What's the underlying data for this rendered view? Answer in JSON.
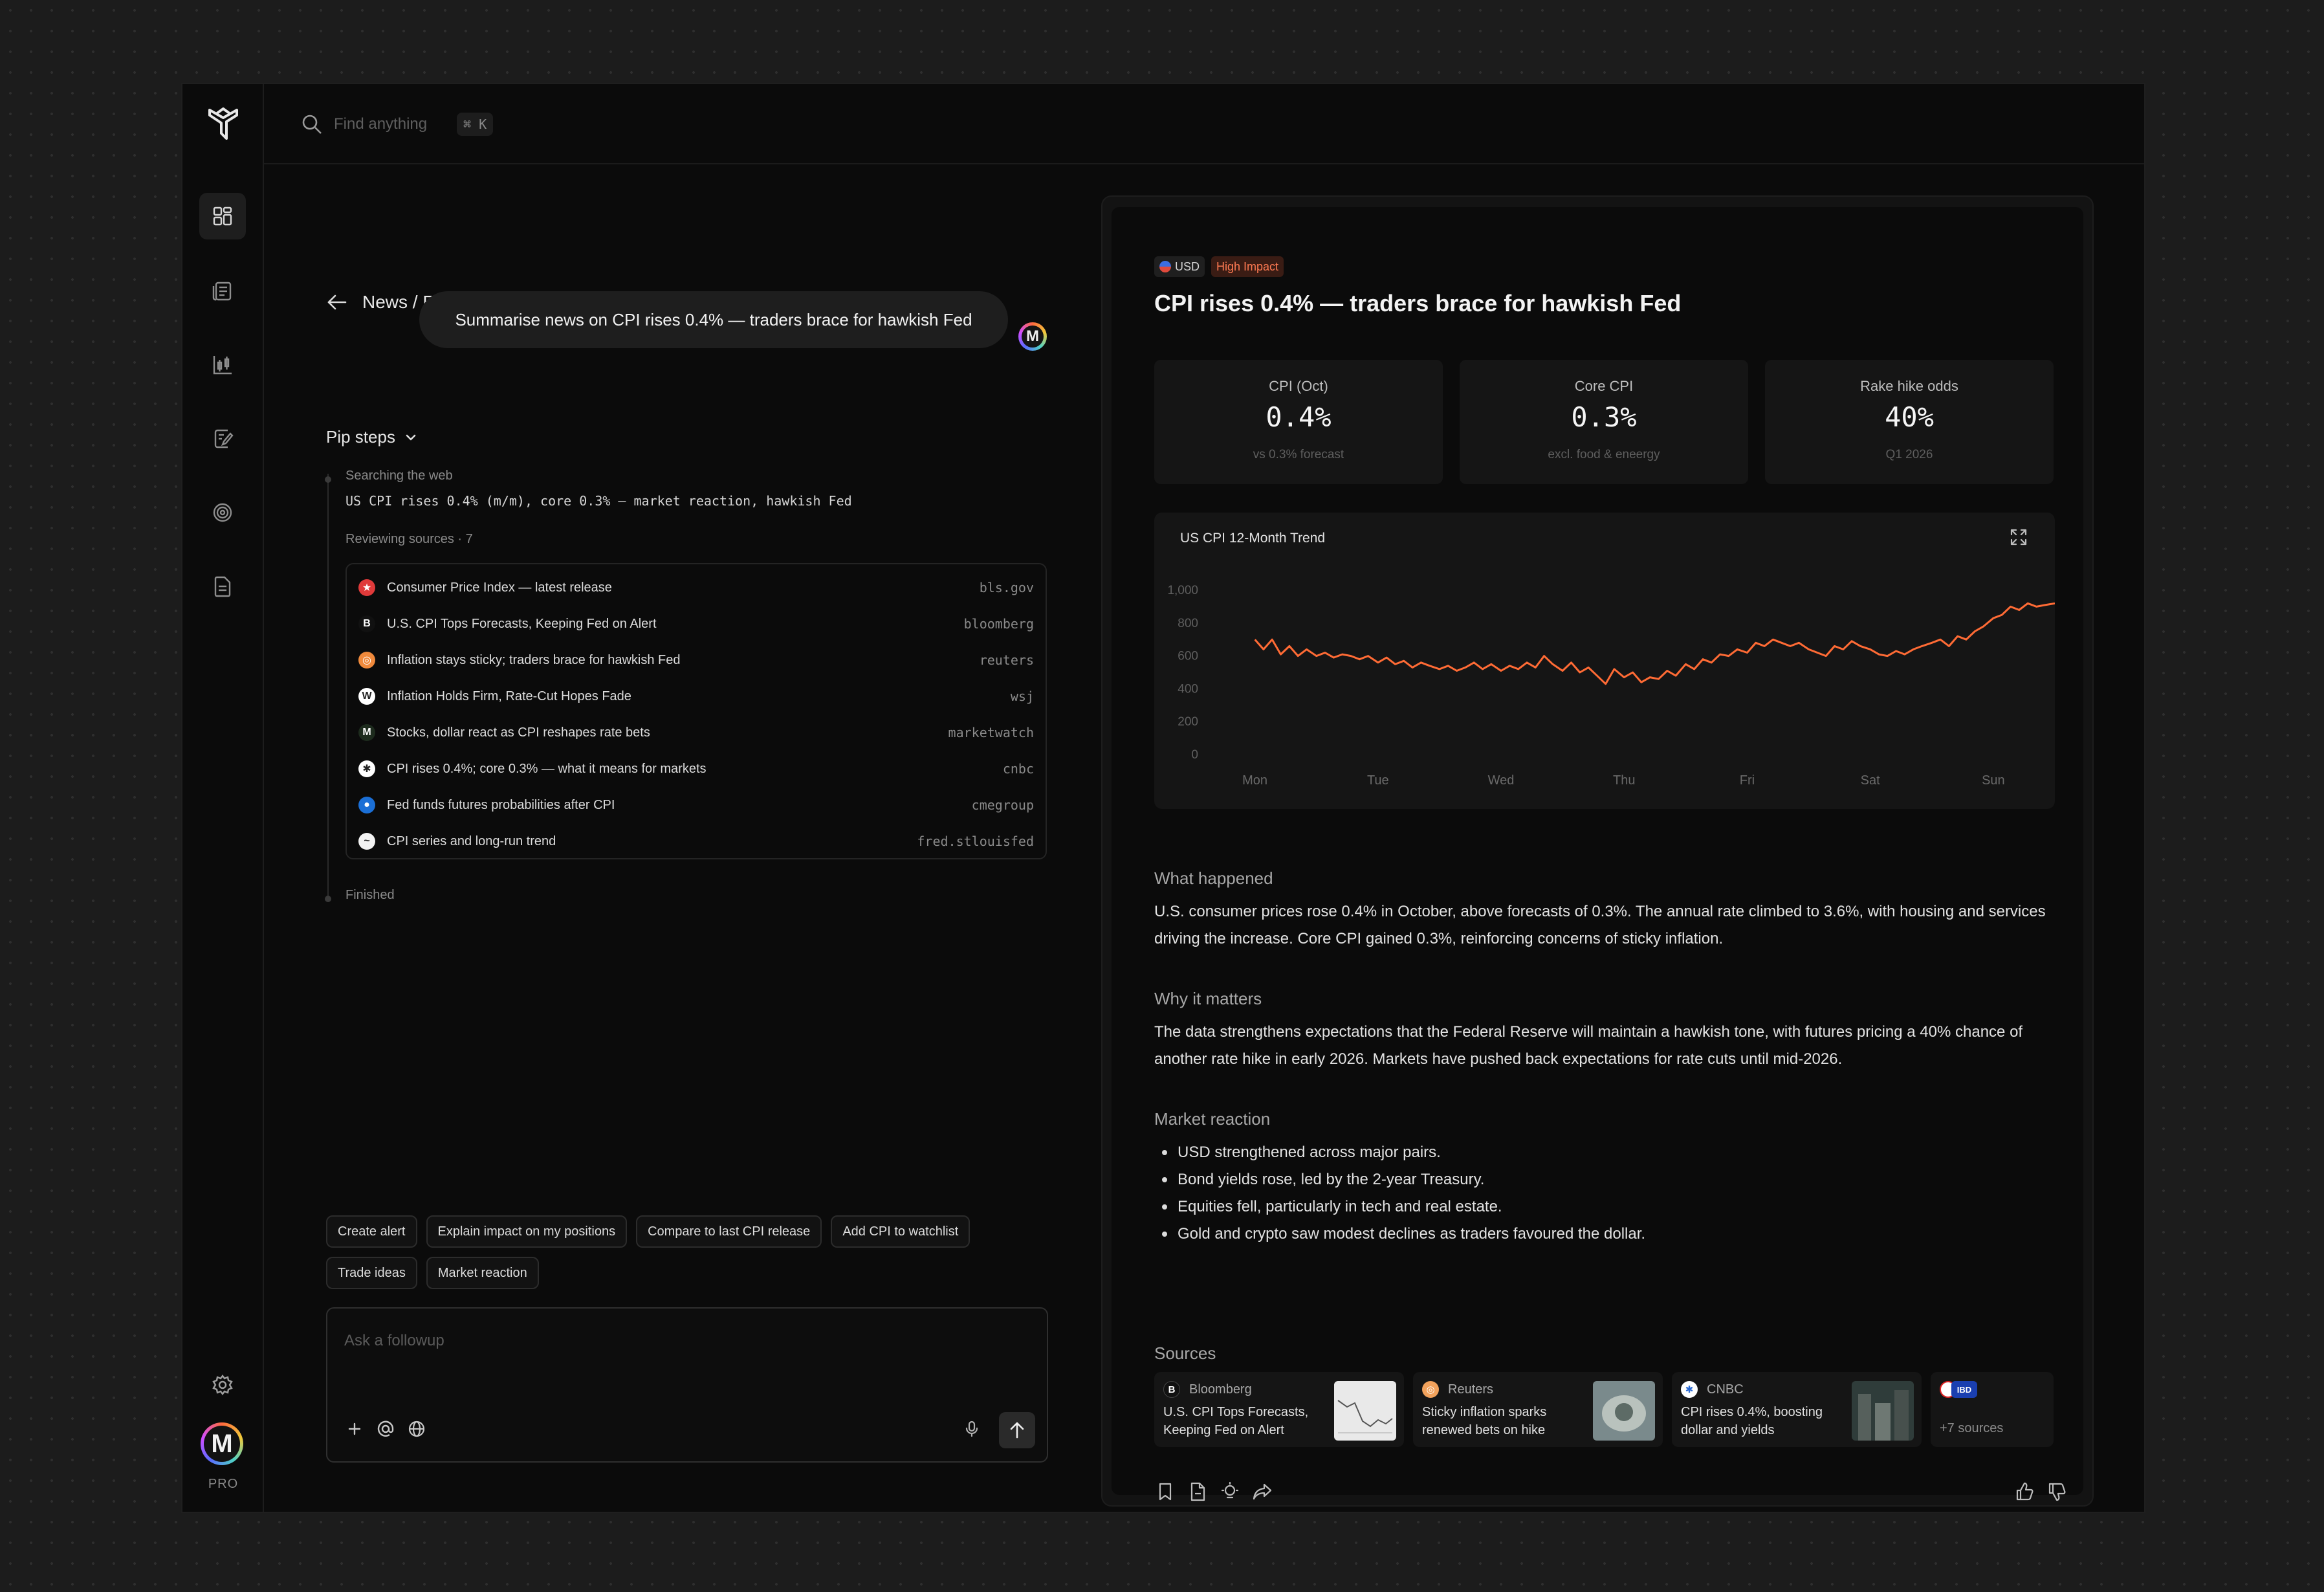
{
  "search": {
    "placeholder": "Find anything",
    "shortcut": "⌘ K"
  },
  "user": {
    "avatar_initial": "M",
    "plan": "PRO"
  },
  "breadcrumb": "News / Economy",
  "conversation": {
    "user_message": "Summarise news on CPI rises 0.4% — traders brace for hawkish Fed"
  },
  "pip_steps": {
    "toggle_label": "Pip steps",
    "searching_label": "Searching the web",
    "query": "US CPI rises 0.4% (m/m), core 0.3% — market reaction, hawkish Fed",
    "reviewing_label": "Reviewing sources · 7",
    "sources": [
      {
        "title": "Consumer Price Index — latest release",
        "domain": "bls.gov",
        "icon": "bls-icon",
        "color": "#e03a3a",
        "glyph": "★"
      },
      {
        "title": "U.S. CPI Tops Forecasts, Keeping Fed on Alert",
        "domain": "bloomberg",
        "icon": "bloomberg-icon",
        "color": "#111111",
        "glyph": "B"
      },
      {
        "title": "Inflation stays sticky; traders brace for hawkish Fed",
        "domain": "reuters",
        "icon": "reuters-icon",
        "color": "#f08a3c",
        "glyph": "◎"
      },
      {
        "title": "Inflation Holds Firm, Rate-Cut Hopes Fade",
        "domain": "wsj",
        "icon": "wsj-icon",
        "color": "#ffffff",
        "glyph": "W"
      },
      {
        "title": "Stocks, dollar react as CPI reshapes rate bets",
        "domain": "marketwatch",
        "icon": "marketwatch-icon",
        "color": "#1d2b1d",
        "glyph": "M"
      },
      {
        "title": "CPI rises 0.4%; core 0.3% — what it means for markets",
        "domain": "cnbc",
        "icon": "cnbc-icon",
        "color": "#ffffff",
        "glyph": "✱"
      },
      {
        "title": "Fed funds futures probabilities after CPI",
        "domain": "cmegroup",
        "icon": "cmegroup-icon",
        "color": "#1b6fd6",
        "glyph": "●"
      },
      {
        "title": "CPI series and long-run trend",
        "domain": "fred.stlouisfed",
        "icon": "fred-icon",
        "color": "#f3f3f3",
        "glyph": "~"
      }
    ],
    "finished_label": "Finished"
  },
  "suggestions": [
    "Create alert",
    "Explain impact on my positions",
    "Compare to last CPI release",
    "Add CPI to watchlist",
    "Trade ideas",
    "Market reaction"
  ],
  "composer": {
    "placeholder": "Ask a followup"
  },
  "article": {
    "currency_tag": "USD",
    "impact_tag": "High Impact",
    "title": "CPI rises 0.4% — traders brace for hawkish Fed",
    "stats": [
      {
        "label": "CPI (Oct)",
        "value": "0.4%",
        "sub": "vs 0.3% forecast"
      },
      {
        "label": "Core CPI",
        "value": "0.3%",
        "sub": "excl. food & eneergy"
      },
      {
        "label": "Rake hike odds",
        "value": "40%",
        "sub": "Q1 2026"
      }
    ],
    "what_happened_heading": "What happened",
    "what_happened_body": "U.S. consumer prices rose 0.4% in October, above forecasts of 0.3%. The annual rate climbed to 3.6%, with housing and services driving the increase. Core CPI gained 0.3%, reinforcing concerns of sticky inflation.",
    "why_matters_heading": "Why it matters",
    "why_matters_body": "The data strengthens expectations that the Federal Reserve will maintain a hawkish tone, with futures pricing a 40% chance of another rate hike in early 2026. Markets have pushed back expectations for rate cuts until mid-2026.",
    "market_reaction_heading": "Market reaction",
    "market_reaction_bullets": [
      "USD strengthened across major pairs.",
      "Bond yields rose, led by the 2-year Treasury.",
      "Equities fell, particularly in tech and real estate.",
      "Gold and crypto saw modest declines as traders favoured the dollar."
    ],
    "sources_heading": "Sources",
    "source_cards": [
      {
        "name": "Bloomberg",
        "headline": "U.S. CPI Tops Forecasts, Keeping Fed on Alert"
      },
      {
        "name": "Reuters",
        "headline": "Sticky inflation sparks renewed bets on hike"
      },
      {
        "name": "CNBC",
        "headline": "CPI rises 0.4%, boosting dollar and yields"
      }
    ],
    "more_sources_badge": "IBD",
    "more_sources": "+7 sources"
  },
  "chart_data": {
    "type": "line",
    "title": "US CPI 12-Month Trend",
    "categories": [
      "Mon",
      "Tue",
      "Wed",
      "Thu",
      "Fri",
      "Sat",
      "Sun"
    ],
    "y_ticks": [
      "0",
      "200",
      "400",
      "600",
      "800",
      "1,000"
    ],
    "ylim": [
      0,
      1000
    ],
    "grid": false,
    "color": "#ff6b35",
    "x": [
      0,
      0.07,
      0.14,
      0.21,
      0.28,
      0.35,
      0.42,
      0.5,
      0.57,
      0.64,
      0.71,
      0.78,
      0.85,
      0.92,
      1.0,
      1.07,
      1.14,
      1.21,
      1.28,
      1.35,
      1.42,
      1.5,
      1.57,
      1.64,
      1.71,
      1.78,
      1.85,
      1.92,
      2.0,
      2.07,
      2.14,
      2.21,
      2.28,
      2.35,
      2.42,
      2.5,
      2.57,
      2.64,
      2.71,
      2.78,
      2.85,
      2.92,
      3.0,
      3.07,
      3.14,
      3.21,
      3.28,
      3.35,
      3.42,
      3.5,
      3.57,
      3.64,
      3.71,
      3.78,
      3.85,
      3.92,
      4.0,
      4.07,
      4.14,
      4.21,
      4.28,
      4.35,
      4.42,
      4.5,
      4.57,
      4.64,
      4.71,
      4.78,
      4.85,
      4.92,
      5.0,
      5.07,
      5.14,
      5.21,
      5.28,
      5.35,
      5.42,
      5.5,
      5.57,
      5.64,
      5.71,
      5.78,
      5.85,
      5.92,
      6.0,
      6.07,
      6.14,
      6.21,
      6.28,
      6.35,
      6.42,
      6.5
    ],
    "series": [
      {
        "values": [
          700,
          640,
          700,
          610,
          660,
          600,
          640,
          600,
          620,
          590,
          610,
          600,
          580,
          600,
          560,
          590,
          550,
          570,
          530,
          560,
          540,
          520,
          540,
          510,
          530,
          560,
          520,
          550,
          510,
          540,
          520,
          560,
          530,
          600,
          550,
          510,
          560,
          500,
          530,
          480,
          430,
          520,
          470,
          500,
          440,
          470,
          460,
          510,
          480,
          550,
          520,
          580,
          560,
          610,
          600,
          640,
          620,
          680,
          660,
          700,
          680,
          660,
          680,
          640,
          620,
          600,
          660,
          640,
          690,
          660,
          640,
          610,
          600,
          630,
          610,
          640,
          660,
          680,
          700,
          660,
          720,
          700,
          750,
          780,
          830,
          850,
          900,
          880,
          920,
          900,
          910,
          920
        ]
      }
    ]
  }
}
